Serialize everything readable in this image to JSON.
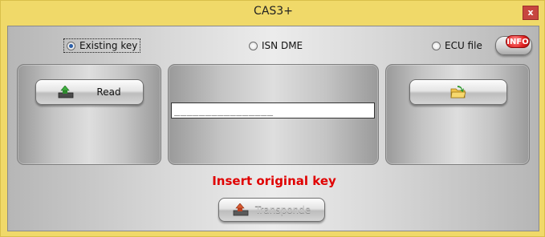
{
  "window": {
    "title": "CAS3+",
    "close_label": "x"
  },
  "mode_options": [
    {
      "label": "Existing key",
      "selected": true
    },
    {
      "label": "ISN DME",
      "selected": false
    },
    {
      "label": "ECU file",
      "selected": false
    }
  ],
  "info_button": {
    "label": "INFO"
  },
  "read_button": {
    "label": "Read",
    "icon": "upload-icon"
  },
  "open_file_button": {
    "icon": "open-folder-icon"
  },
  "code_field": {
    "value": "________________"
  },
  "status_message": "Insert original key",
  "transponder_button": {
    "label": "Transponde",
    "icon": "upload-icon",
    "enabled": false
  },
  "colors": {
    "titlebar": "#f0d969",
    "status_message": "#e00000",
    "info_badge": "#e02020"
  }
}
